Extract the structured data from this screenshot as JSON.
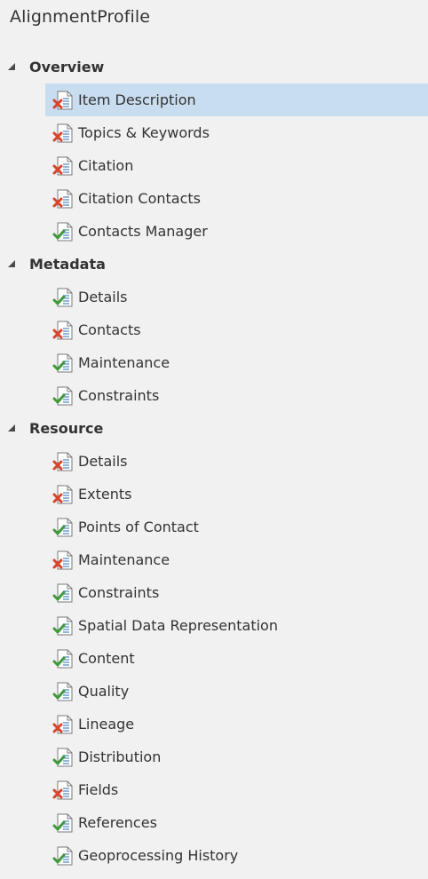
{
  "title": "AlignmentProfile",
  "sections": [
    {
      "label": "Overview",
      "items": [
        {
          "label": "Item Description",
          "status": "error",
          "selected": true
        },
        {
          "label": "Topics & Keywords",
          "status": "error"
        },
        {
          "label": "Citation",
          "status": "error"
        },
        {
          "label": "Citation Contacts",
          "status": "error"
        },
        {
          "label": "Contacts Manager",
          "status": "ok"
        }
      ]
    },
    {
      "label": "Metadata",
      "items": [
        {
          "label": "Details",
          "status": "ok"
        },
        {
          "label": "Contacts",
          "status": "error"
        },
        {
          "label": "Maintenance",
          "status": "ok"
        },
        {
          "label": "Constraints",
          "status": "ok"
        }
      ]
    },
    {
      "label": "Resource",
      "items": [
        {
          "label": "Details",
          "status": "error"
        },
        {
          "label": "Extents",
          "status": "error"
        },
        {
          "label": "Points of Contact",
          "status": "ok"
        },
        {
          "label": "Maintenance",
          "status": "error"
        },
        {
          "label": "Constraints",
          "status": "ok"
        },
        {
          "label": "Spatial Data Representation",
          "status": "ok"
        },
        {
          "label": "Content",
          "status": "ok"
        },
        {
          "label": "Quality",
          "status": "ok"
        },
        {
          "label": "Lineage",
          "status": "error"
        },
        {
          "label": "Distribution",
          "status": "ok"
        },
        {
          "label": "Fields",
          "status": "error"
        },
        {
          "label": "References",
          "status": "ok"
        },
        {
          "label": "Geoprocessing History",
          "status": "ok"
        }
      ]
    }
  ],
  "colors": {
    "background": "#f1f1f1",
    "selection": "#c9ddf0",
    "error_icon": "#d9442b",
    "ok_icon": "#3f9a3a",
    "doc_outline": "#7a7a7a",
    "doc_lines": "#5b8fc7"
  },
  "icons": {
    "ok": "document-check-icon",
    "error": "document-error-icon",
    "caret": "caret-expanded-icon"
  }
}
